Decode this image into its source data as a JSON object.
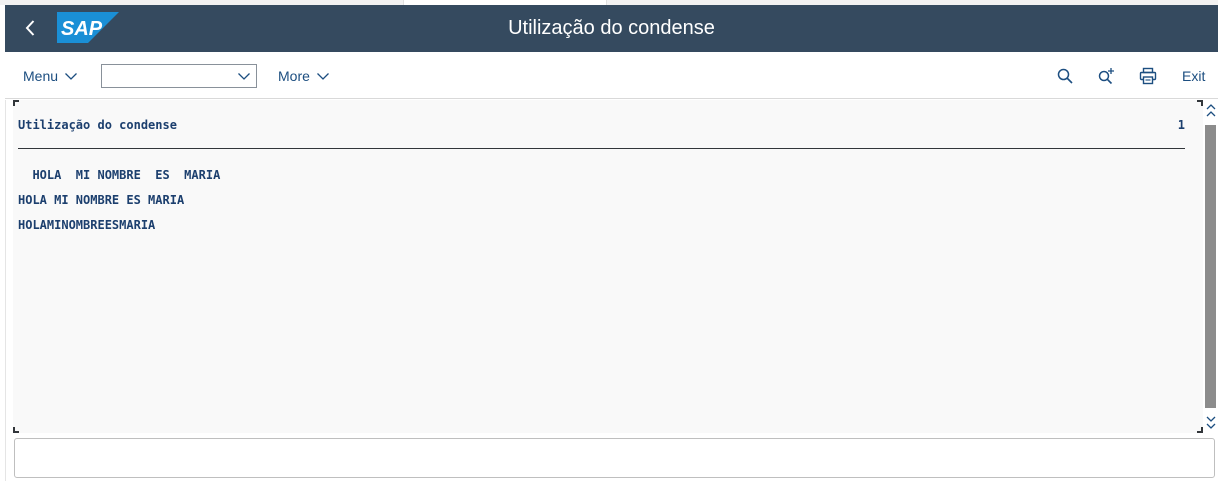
{
  "shell": {
    "title": "Utilização do condense",
    "logo_text": "SAP",
    "brand_color": "#354a5f",
    "logo_color": "#1a8fd6"
  },
  "toolbar": {
    "menu_label": "Menu",
    "dropdown_value": "",
    "more_label": "More",
    "search_icon": "search-icon",
    "search_more_icon": "search-next-icon",
    "print_icon": "print-icon",
    "exit_label": "Exit"
  },
  "report": {
    "title": "Utilização do condense",
    "page_number": "1",
    "lines": [
      "  HOLA  MI NOMBRE  ES  MARIA",
      "HOLA MI NOMBRE ES MARIA",
      "HOLAMINOMBREESMARIA"
    ]
  },
  "command_field": {
    "value": ""
  }
}
